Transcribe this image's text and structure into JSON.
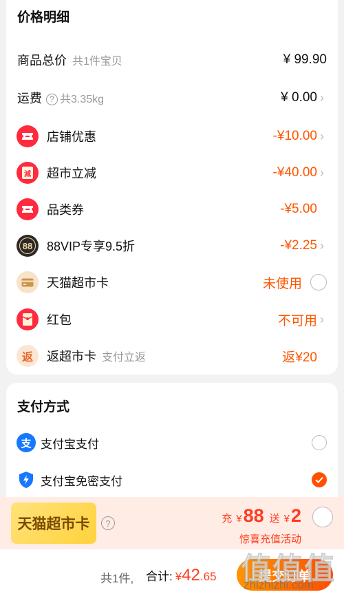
{
  "price_section": {
    "title": "价格明细",
    "total": {
      "label": "商品总价",
      "sub": "共1件宝贝",
      "value": "¥ 99.90"
    },
    "shipping": {
      "label": "运费",
      "sub": "共3.35kg",
      "value": "¥ 0.00"
    },
    "items": [
      {
        "icon": "coupon-ticket-icon",
        "label": "店铺优惠",
        "value": "-¥10.00"
      },
      {
        "icon": "supermarket-discount-icon",
        "icon_text": "減",
        "label": "超市立减",
        "value": "-¥40.00"
      },
      {
        "icon": "category-coupon-icon",
        "label": "品类券",
        "value": "-¥5.00"
      },
      {
        "icon": "88vip-icon",
        "icon_text": "88",
        "label": "88VIP专享9.5折",
        "value": "-¥2.25"
      },
      {
        "icon": "card-icon",
        "label": "天猫超市卡",
        "value": "未使用"
      },
      {
        "icon": "red-envelope-icon",
        "label": "红包",
        "value": "不可用"
      },
      {
        "icon": "cashback-icon",
        "icon_text": "返",
        "label": "返超市卡",
        "sub": "支付立返",
        "value": "返¥20"
      }
    ]
  },
  "payment_section": {
    "title": "支付方式",
    "options": [
      {
        "icon": "alipay-icon",
        "icon_text": "支",
        "label": "支付宝支付",
        "selected": false
      },
      {
        "icon": "alipay-passwordless-icon",
        "label": "支付宝免密支付",
        "selected": true
      }
    ]
  },
  "banner": {
    "tag": "天猫超市卡",
    "recharge_prefix": "充",
    "currency": "¥",
    "recharge_amount": "88",
    "gift_prefix": "送",
    "gift_amount": "2",
    "subtitle": "惊喜充值活动"
  },
  "footer": {
    "count": "共1件,",
    "total_label": "合计:",
    "currency": "¥",
    "total_int": "42",
    "total_dec": ".65",
    "submit": "提交订单"
  },
  "watermark": {
    "title": "值值值",
    "url": "zhizhizhi.com"
  },
  "colors": {
    "accent": "#ff5500",
    "red": "#ff3b1f",
    "vip": "#333333",
    "gold": "#ffd23d"
  }
}
